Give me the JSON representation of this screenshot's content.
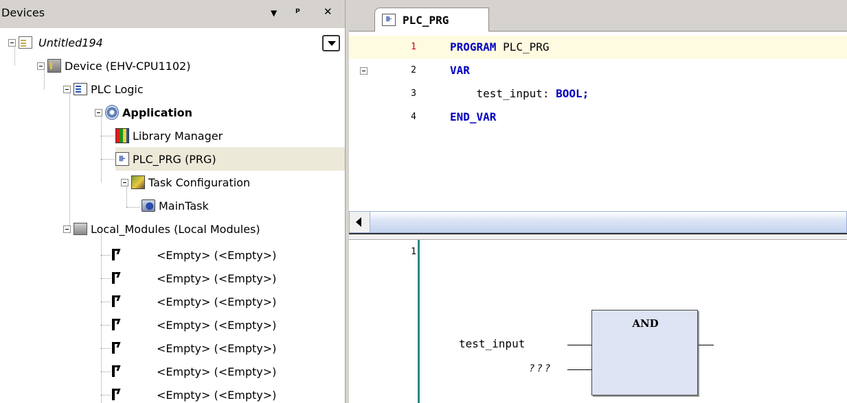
{
  "devices_panel": {
    "title": "Devices",
    "header_buttons": {
      "menu": "▼",
      "pin": "ᵖ",
      "close": "✕"
    }
  },
  "tree": {
    "root": {
      "label": "Untitled194",
      "icon": "project-icon"
    },
    "device": {
      "label": "Device (EHV-CPU1102)",
      "icon": "device-icon"
    },
    "plc_logic": {
      "label": "PLC Logic",
      "icon": "plc-logic-icon"
    },
    "application": {
      "label": "Application",
      "icon": "application-icon"
    },
    "library_manager": {
      "label": "Library Manager",
      "icon": "library-manager-icon"
    },
    "plc_prg": {
      "label": "PLC_PRG (PRG)",
      "icon": "pou-icon"
    },
    "task_configuration": {
      "label": "Task Configuration",
      "icon": "task-configuration-icon"
    },
    "main_task": {
      "label": "MainTask",
      "icon": "task-icon"
    },
    "local_modules": {
      "label": "Local_Modules (Local Modules)",
      "icon": "module-icon"
    },
    "empty_slots": [
      {
        "label": "<Empty> (<Empty>)"
      },
      {
        "label": "<Empty> (<Empty>)"
      },
      {
        "label": "<Empty> (<Empty>)"
      },
      {
        "label": "<Empty> (<Empty>)"
      },
      {
        "label": "<Empty> (<Empty>)"
      },
      {
        "label": "<Empty> (<Empty>)"
      },
      {
        "label": "<Empty> (<Empty>)"
      }
    ]
  },
  "editor": {
    "tab_label": "PLC_PRG",
    "tab_icon_glyph": "⊪",
    "declaration": {
      "line_numbers": [
        "1",
        "2",
        "3",
        "4"
      ],
      "line1_kw": "PROGRAM",
      "line1_rest": " PLC_PRG",
      "line2_kw": "VAR",
      "line3_indent": "    test_input: ",
      "line3_type": "BOOL;",
      "line4_kw": "END_VAR"
    },
    "fbd": {
      "line_number": "1",
      "block_name": "AND",
      "input1": "test_input",
      "input2": "???"
    }
  },
  "colors": {
    "keyword": "#0000c0",
    "current_line": "#fffbe0",
    "block_fill": "#dee4f4",
    "gutter_line": "#2a8a8a",
    "panel_header": "#d6d3ce"
  }
}
